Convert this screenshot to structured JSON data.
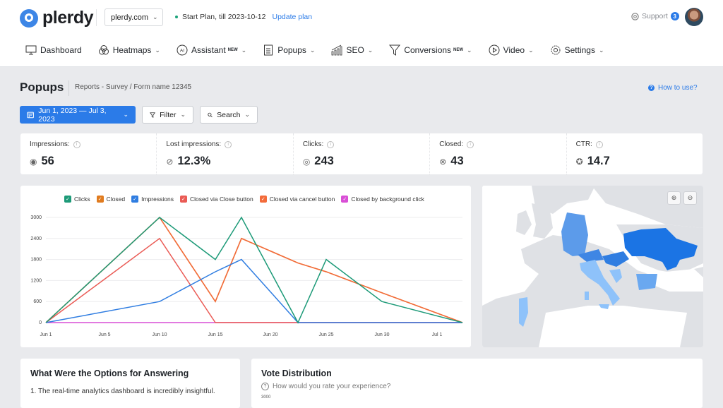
{
  "header": {
    "brand": "plerdy",
    "site": "plerdy.com",
    "plan_text": "Start Plan, till 2023-10-12",
    "update_plan": "Update plan",
    "support": "Support",
    "support_count": "3"
  },
  "nav": [
    {
      "label": "Dashboard",
      "icon": "monitor-icon",
      "new": "",
      "chevron": false
    },
    {
      "label": "Heatmaps",
      "icon": "heatmaps-icon",
      "new": "",
      "chevron": true
    },
    {
      "label": "Assistant",
      "icon": "ai-icon",
      "new": "NEW",
      "chevron": true
    },
    {
      "label": "Popups",
      "icon": "document-icon",
      "new": "",
      "chevron": true
    },
    {
      "label": "SEO",
      "icon": "seo-chart-icon",
      "new": "",
      "chevron": true
    },
    {
      "label": "Conversions",
      "icon": "funnel-icon",
      "new": "NEW",
      "chevron": true
    },
    {
      "label": "Video",
      "icon": "play-icon",
      "new": "",
      "chevron": true
    },
    {
      "label": "Settings",
      "icon": "gear-icon",
      "new": "",
      "chevron": true
    }
  ],
  "page": {
    "title": "Popups",
    "breadcrumb": "Reports - Survey / Form name 12345",
    "how_to": "How to use?"
  },
  "toolbar": {
    "date_range": "Jun 1, 2023 — Jul 3, 2023",
    "filter": "Filter",
    "search": "Search"
  },
  "stats": [
    {
      "label": "Impressions:",
      "value": "56",
      "icon": "eye-icon"
    },
    {
      "label": "Lost impressions:",
      "value": "12.3%",
      "icon": "eye-off-icon"
    },
    {
      "label": "Clicks:",
      "value": "243",
      "icon": "click-icon"
    },
    {
      "label": "Closed:",
      "value": "43",
      "icon": "close-circle-icon"
    },
    {
      "label": "CTR:",
      "value": "14.7",
      "icon": "badge-check-icon"
    }
  ],
  "chart_data": {
    "type": "line",
    "title": "",
    "xlabel": "",
    "ylabel": "",
    "x_ticks": [
      "Jun 1",
      "Jun 5",
      "Jun 10",
      "Jun 15",
      "Jun 20",
      "Jun 25",
      "Jun 30",
      "Jul 1"
    ],
    "x_days": [
      1,
      10,
      15,
      17,
      22,
      24,
      30,
      33
    ],
    "y_ticks": [
      "0",
      "600",
      "1200",
      "1800",
      "2400",
      "3000"
    ],
    "ylim": [
      0,
      3000
    ],
    "legend_position": "top",
    "grid": true,
    "series": [
      {
        "name": "Clicks",
        "color": "#1d9a78",
        "values": [
          0,
          3000,
          1800,
          3000,
          0,
          1800,
          600,
          0
        ]
      },
      {
        "name": "Closed",
        "color": "#e07b1f",
        "values": [
          0,
          3000,
          600,
          2400,
          1700,
          1450,
          850,
          0
        ]
      },
      {
        "name": "Impressions",
        "color": "#2f7de1",
        "values": [
          0,
          600,
          1450,
          1800,
          0,
          0,
          0,
          0
        ]
      },
      {
        "name": "Closed via Close button",
        "color": "#ea5b55",
        "values": [
          0,
          2400,
          0,
          0,
          0,
          0,
          0,
          0
        ]
      },
      {
        "name": "Closed via cancel button",
        "color": "#f36b3a",
        "values": [
          0,
          3000,
          600,
          2400,
          1700,
          1450,
          850,
          0
        ]
      },
      {
        "name": "Closed by background click",
        "color": "#d94fd6",
        "values": [
          0,
          0,
          0,
          0,
          0,
          0,
          0,
          0
        ]
      }
    ]
  },
  "map": {
    "zoom_in": "+",
    "zoom_out": "−",
    "highlighted_countries": [
      "Ukraine",
      "Germany",
      "Austria",
      "Hungary",
      "Italy",
      "Bosnia and Herzegovina",
      "Bulgaria",
      "Portugal"
    ]
  },
  "options_card": {
    "title": "What Were the Options for Answering",
    "items": [
      "1. The real-time analytics dashboard is incredibly insightful."
    ]
  },
  "vote_card": {
    "title": "Vote Distribution",
    "question": "How would you rate your experience?",
    "y_top": "3000"
  }
}
